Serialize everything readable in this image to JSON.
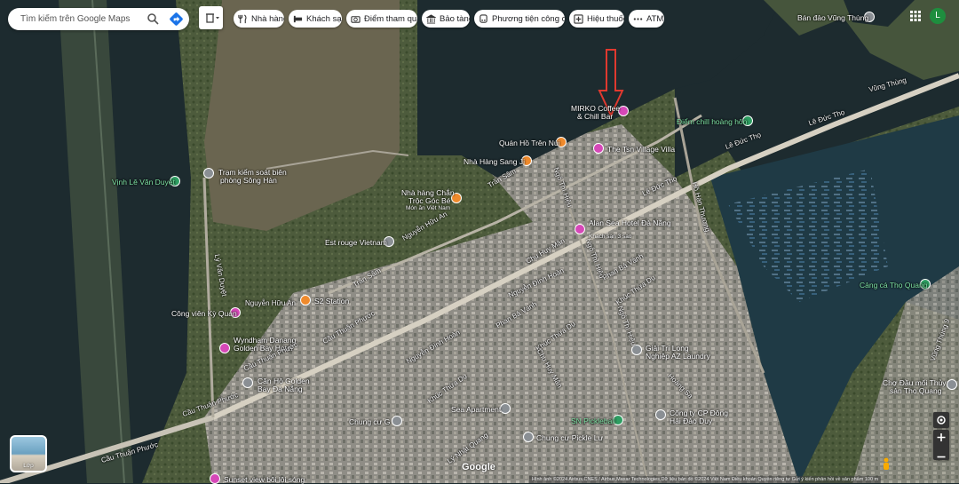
{
  "search": {
    "query": "Tìm kiếm trên Google Maps"
  },
  "chips": [
    {
      "label": "Nhà hàng",
      "icon": "restaurant-icon"
    },
    {
      "label": "Khách sạn",
      "icon": "hotel-icon"
    },
    {
      "label": "Điểm tham quan",
      "icon": "camera-icon"
    },
    {
      "label": "Bảo tàng",
      "icon": "museum-icon"
    },
    {
      "label": "Phương tiện công cộ...",
      "icon": "transit-icon"
    },
    {
      "label": "Hiệu thuốc",
      "icon": "pharmacy-icon"
    },
    {
      "label": "ATM",
      "icon": "more-icon"
    }
  ],
  "account": {
    "initial": "L"
  },
  "places": [
    {
      "name": "Bán đảo Vũng Thùng",
      "type": "grey"
    },
    {
      "name": "MIRKO Coffee",
      "type": "pink"
    },
    {
      "name": "& Chill Bar",
      "type": "none"
    },
    {
      "name": "Điểm chill hoàng hôn",
      "type": "green"
    },
    {
      "name": "Quán Hồ Trên Núi",
      "type": "orange"
    },
    {
      "name": "The Tsn Village Villa",
      "type": "pink"
    },
    {
      "name": "Nhà Hàng Sang Ji",
      "type": "orange"
    },
    {
      "name": "Trạm kiểm soát biên",
      "type": "grey"
    },
    {
      "name": "phòng Sông Hàn",
      "type": "none"
    },
    {
      "name": "Vịnh Lê Văn Duyệt",
      "type": "green"
    },
    {
      "name": "Nhà hàng Chắn",
      "type": "orange"
    },
    {
      "name": "Trộc Góc Bé",
      "type": "none"
    },
    {
      "name": "Món ăn Việt Nam",
      "type": "none"
    },
    {
      "name": "Alan Sea Hotel Đà Nẵng",
      "type": "pink"
    },
    {
      "name": "Khách sạn 3 sao",
      "type": "none"
    },
    {
      "name": "Est rouge Vietnam",
      "type": "grey"
    },
    {
      "name": "S2 Station",
      "type": "orange"
    },
    {
      "name": "Công viên Kỳ Quan",
      "type": "pink"
    },
    {
      "name": "Wyndham Danang",
      "type": "pink"
    },
    {
      "name": "Golden Bay Hotel",
      "type": "none"
    },
    {
      "name": "Căn Hộ Golden",
      "type": "grey"
    },
    {
      "name": "Bay Đà Nẵng",
      "type": "none"
    },
    {
      "name": "Giải Trí Long",
      "type": "grey"
    },
    {
      "name": "Nghiệp AZ Laundry",
      "type": "none"
    },
    {
      "name": "Cảng cá Thọ Quang",
      "type": "green"
    },
    {
      "name": "Chợ Đầu mối Thủy",
      "type": "grey"
    },
    {
      "name": "sản Thọ Quang",
      "type": "none"
    },
    {
      "name": "Chung cư G",
      "type": "grey"
    },
    {
      "name": "Sea Apartment",
      "type": "grey"
    },
    {
      "name": "SN Pickleball",
      "type": "green"
    },
    {
      "name": "Công ty CP Đông",
      "type": "grey"
    },
    {
      "name": "Hải Đảo Duy",
      "type": "none"
    },
    {
      "name": "Chung cư Pickle Lư",
      "type": "grey"
    },
    {
      "name": "Sunset view bôi lội sóng",
      "type": "pink"
    }
  ],
  "roads": [
    "Lê Đức Thọ",
    "Lê Đức Thọ",
    "Lê Đức Thọ",
    "Vũng Thùng",
    "Trần Sâm",
    "Trần Sâm",
    "Nguyễn Hữu An",
    "Nguyễn Hữu An",
    "Ngô Thì Hiệu",
    "Hồ Hán Thương",
    "Chu Huy Mân",
    "Nguyễn Đình Hoàn",
    "Phan Bá Vành",
    "Phan Bá Vành",
    "Khúc Thừa Dụ",
    "Khúc Thừa Dụ",
    "Khúc Thừa Dụ",
    "Cầu Thuận Phước",
    "Cầu Thuận Phước",
    "Cầu Thuận Phước",
    "Cầu Thuận Phước",
    "Lý Văn Duyệt",
    "Lý Nhật Quang",
    "Hoàng Sa",
    "Vũng Thùng 9",
    "Nguyễn Đình Hoàn",
    "Chu Huy Mân",
    "Ngô Thì Hiệu",
    "Ngô Thì Hiệu"
  ],
  "watermark": "© 2024 Google",
  "logo": "Google",
  "footer": "Hình ảnh ©2024 Airbus,CNES / Airbus,Maxar Technologies,Dữ liệu bản đồ ©2024   Việt Nam   Điều khoản   Quyền riêng tư   Gửi ý kiến phản hồi về sản phẩm   100 m",
  "thumb": {
    "label": "Lớp"
  }
}
